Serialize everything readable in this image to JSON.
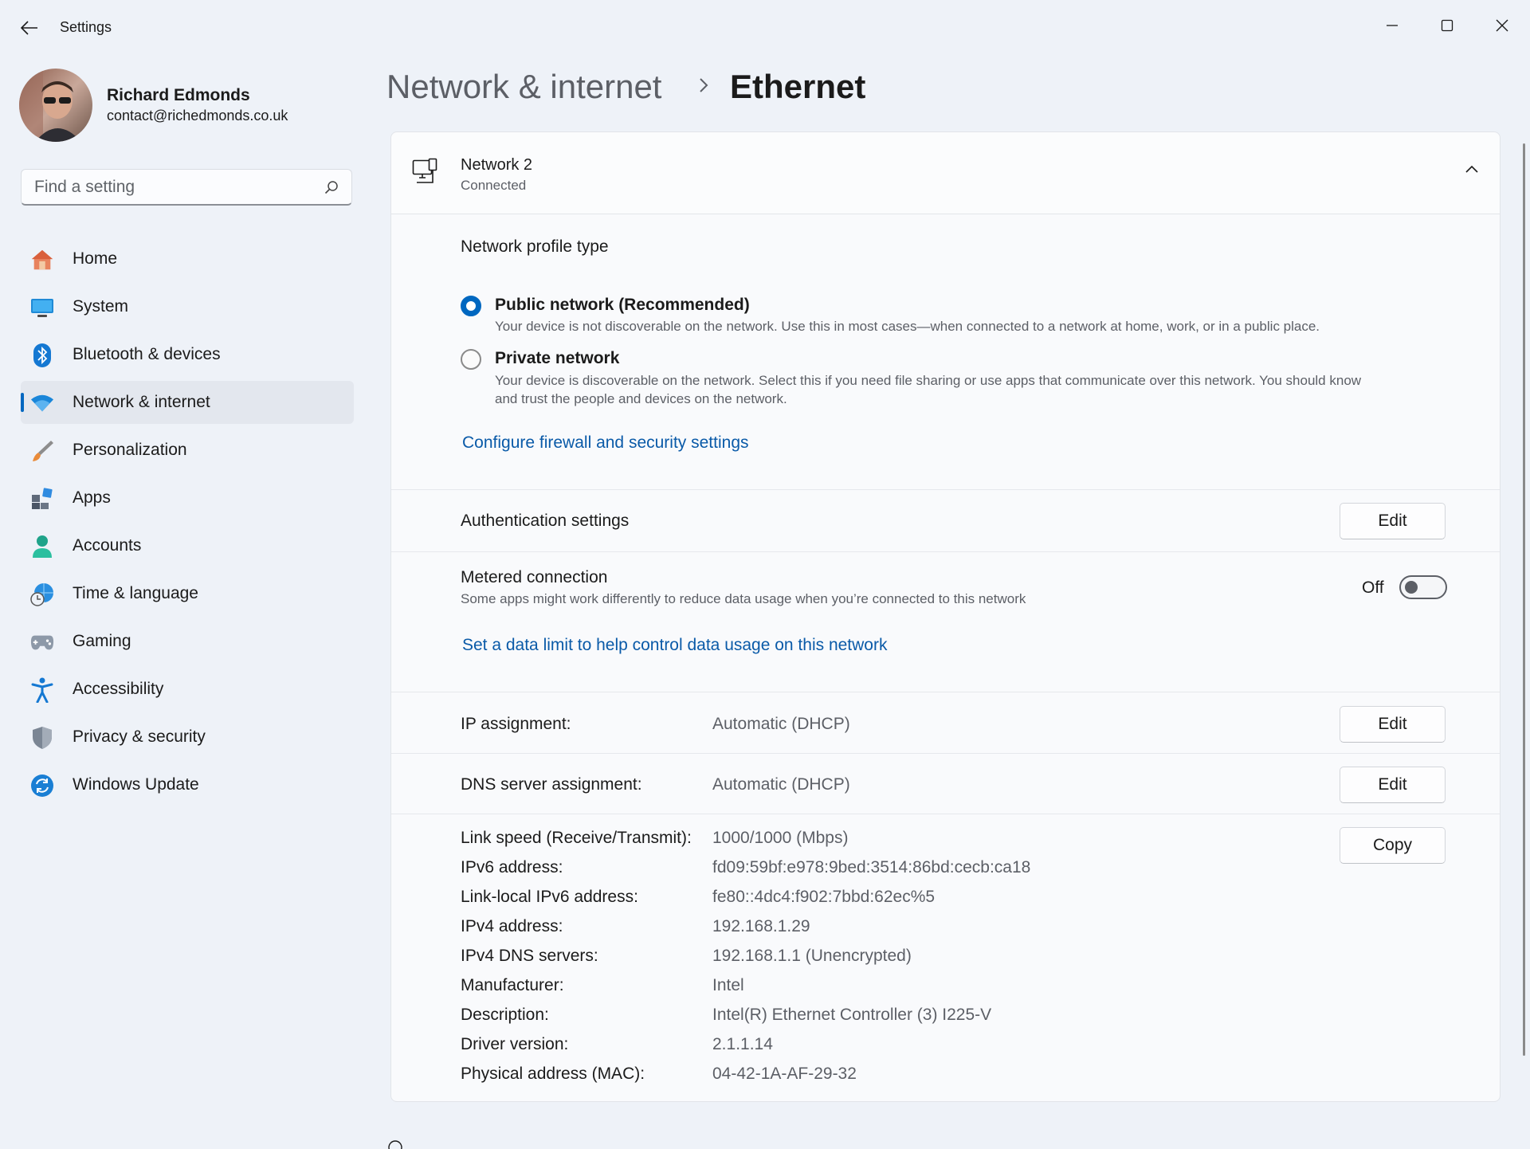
{
  "window": {
    "title": "Settings"
  },
  "profile": {
    "name": "Richard Edmonds",
    "email": "contact@richedmonds.co.uk"
  },
  "search": {
    "placeholder": "Find a setting"
  },
  "sidebar": {
    "items": [
      {
        "label": "Home",
        "icon": "home-icon"
      },
      {
        "label": "System",
        "icon": "system-icon"
      },
      {
        "label": "Bluetooth & devices",
        "icon": "bluetooth-icon"
      },
      {
        "label": "Network & internet",
        "icon": "wifi-icon",
        "active": true
      },
      {
        "label": "Personalization",
        "icon": "brush-icon"
      },
      {
        "label": "Apps",
        "icon": "apps-icon"
      },
      {
        "label": "Accounts",
        "icon": "person-icon"
      },
      {
        "label": "Time & language",
        "icon": "globe-clock-icon"
      },
      {
        "label": "Gaming",
        "icon": "gamepad-icon"
      },
      {
        "label": "Accessibility",
        "icon": "accessibility-icon"
      },
      {
        "label": "Privacy & security",
        "icon": "shield-icon"
      },
      {
        "label": "Windows Update",
        "icon": "update-icon"
      }
    ]
  },
  "breadcrumb": {
    "parent": "Network & internet",
    "current": "Ethernet"
  },
  "network": {
    "name": "Network 2",
    "status": "Connected"
  },
  "profile_type": {
    "title": "Network profile type",
    "public": {
      "label": "Public network (Recommended)",
      "description": "Your device is not discoverable on the network. Use this in most cases—when connected to a network at home, work, or in a public place.",
      "selected": true
    },
    "private": {
      "label": "Private network",
      "description_line1": "Your device is discoverable on the network. Select this if you need file sharing or use apps that communicate over this network. You should know",
      "description_line2": "and trust the people and devices on the network.",
      "selected": false
    },
    "firewall_link": "Configure firewall and security settings"
  },
  "authentication": {
    "label": "Authentication settings",
    "button": "Edit"
  },
  "metered": {
    "label": "Metered connection",
    "description": "Some apps might work differently to reduce data usage when you’re connected to this network",
    "state_label": "Off",
    "on": false,
    "data_limit_link": "Set a data limit to help control data usage on this network"
  },
  "ip_assignment": {
    "label": "IP assignment:",
    "value": "Automatic (DHCP)",
    "button": "Edit"
  },
  "dns_assignment": {
    "label": "DNS server assignment:",
    "value": "Automatic (DHCP)",
    "button": "Edit"
  },
  "properties": {
    "copy_button": "Copy",
    "rows": [
      {
        "label": "Link speed (Receive/Transmit):",
        "value": "1000/1000 (Mbps)"
      },
      {
        "label": "IPv6 address:",
        "value": "fd09:59bf:e978:9bed:3514:86bd:cecb:ca18"
      },
      {
        "label": "Link-local IPv6 address:",
        "value": "fe80::4dc4:f902:7bbd:62ec%5"
      },
      {
        "label": "IPv4 address:",
        "value": "192.168.1.29"
      },
      {
        "label": "IPv4 DNS servers:",
        "value": "192.168.1.1 (Unencrypted)"
      },
      {
        "label": "Manufacturer:",
        "value": "Intel"
      },
      {
        "label": "Description:",
        "value": "Intel(R) Ethernet Controller (3) I225-V"
      },
      {
        "label": "Driver version:",
        "value": "2.1.1.14"
      },
      {
        "label": "Physical address (MAC):",
        "value": "04-42-1A-AF-29-32"
      }
    ]
  }
}
